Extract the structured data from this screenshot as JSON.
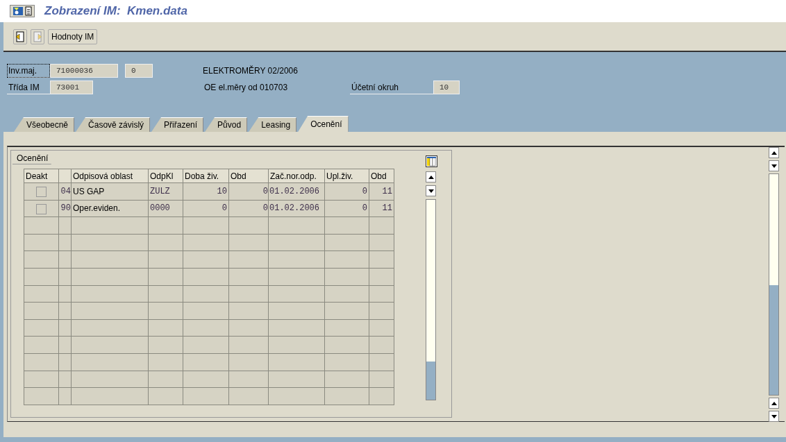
{
  "window": {
    "title": "Zobrazení IM:  Kmen.data"
  },
  "toolbar": {
    "buttons": [
      {
        "kind": "icon"
      },
      {
        "kind": "icon"
      },
      {
        "kind": "text",
        "label": "Hodnoty IM"
      }
    ]
  },
  "header": {
    "rows": [
      {
        "label": "Inv.maj.",
        "focused": true,
        "fields": [
          "71000036",
          "0"
        ],
        "text": "ELEKTROMĚRY 02/2006"
      },
      {
        "label": "Třída IM",
        "focused": false,
        "fields": [
          "73001"
        ],
        "text": "OE el.měry od 010703",
        "label2": "Účetní okruh",
        "field2": "10"
      }
    ]
  },
  "tabs": [
    {
      "label": "Všeobecně",
      "selected": false
    },
    {
      "label": "Časově závislý",
      "selected": false
    },
    {
      "label": "Přiřazení",
      "selected": false
    },
    {
      "label": "Původ",
      "selected": false
    },
    {
      "label": "Leasing",
      "selected": false
    },
    {
      "label": "Ocenění",
      "selected": true
    }
  ],
  "group": {
    "title": "Ocenění"
  },
  "table": {
    "columns": [
      "Deakt",
      "",
      "Odpisová oblast",
      "OdpKl",
      "Doba živ.",
      "Obd",
      "Zač.nor.odp.",
      "Upl.živ.",
      "Obd"
    ],
    "rows": [
      {
        "checked": false,
        "cells": [
          "",
          "04",
          "US GAP",
          "ZULZ",
          "10",
          "0",
          "01.02.2006",
          "0",
          "11"
        ]
      },
      {
        "checked": false,
        "cells": [
          "",
          "90",
          "Oper.eviden.",
          "0000",
          "0",
          "0",
          "01.02.2006",
          "0",
          "11"
        ]
      }
    ]
  }
}
